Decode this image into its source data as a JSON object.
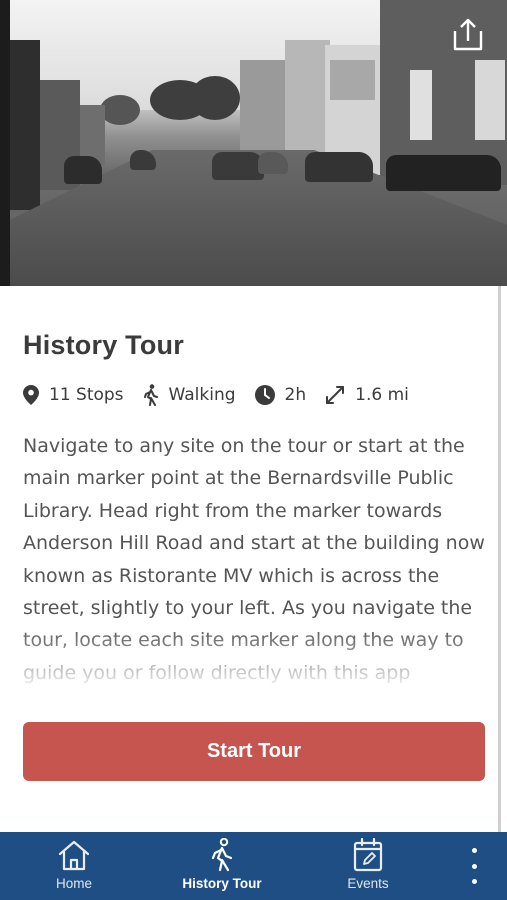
{
  "hero": {
    "image_alt": "Historic black-and-white street scene"
  },
  "tour": {
    "title": "History Tour",
    "stops": "11 Stops",
    "mode": "Walking",
    "duration": "2h",
    "distance": "1.6 mi",
    "description": "Navigate to any site on the tour or start at the main marker point at the Bernardsville Public Library. Head right from the marker towards Anderson Hill Road and start at the building now known as Ristorante MV which is across the street, slightly to your left. As you navigate the tour, locate each site marker along the way to guide you or follow directly with this app"
  },
  "actions": {
    "start_label": "Start Tour"
  },
  "nav": {
    "items": [
      {
        "label": "Home",
        "icon": "home-icon"
      },
      {
        "label": "History Tour",
        "icon": "walking-icon"
      },
      {
        "label": "Events",
        "icon": "calendar-icon"
      }
    ],
    "active": "History Tour"
  },
  "colors": {
    "accent": "#c6554f",
    "nav_bg": "#1f4e84",
    "text": "#3b3b3b"
  }
}
